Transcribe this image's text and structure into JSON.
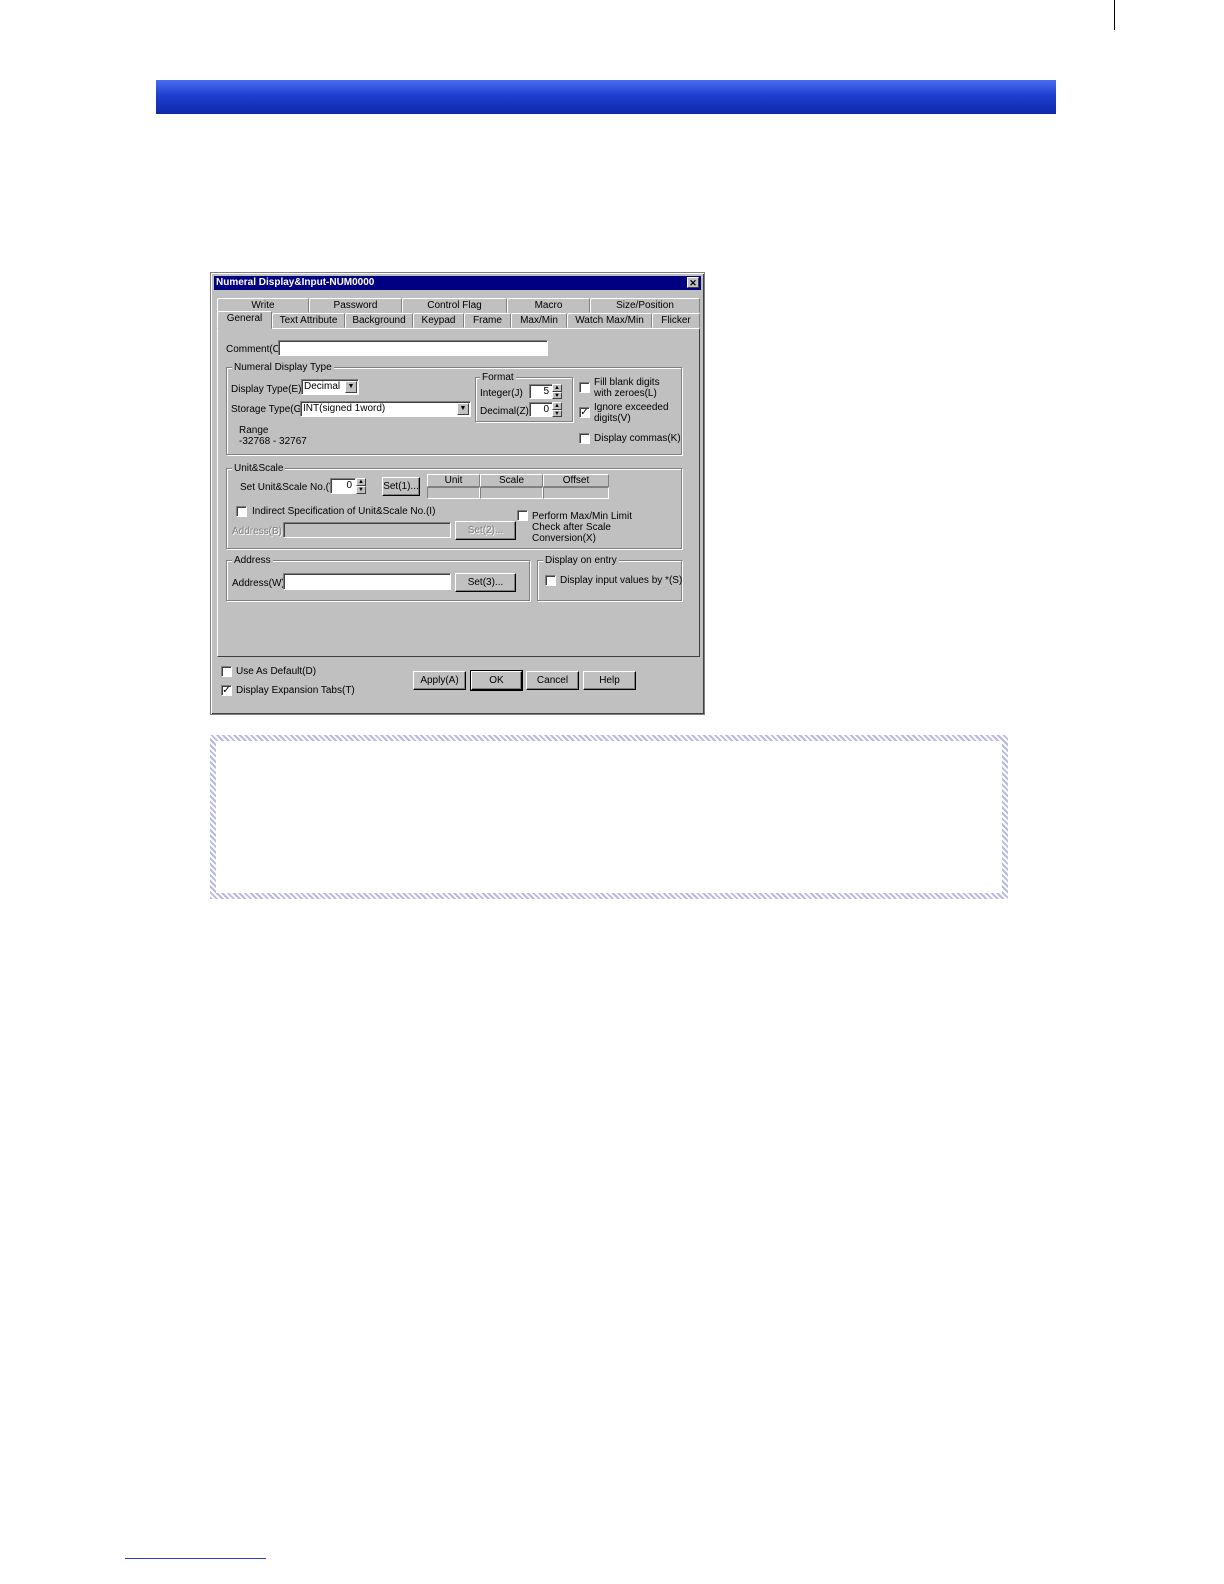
{
  "dialog": {
    "title": "Numeral Display&Input-NUM0000",
    "close_glyph": "✕",
    "tabs_row1": [
      "Write",
      "Password",
      "Control Flag",
      "Macro",
      "Size/Position"
    ],
    "tabs_row2": [
      "General",
      "Text Attribute",
      "Background",
      "Keypad",
      "Frame",
      "Max/Min",
      "Watch Max/Min",
      "Flicker"
    ],
    "active_tab": "General",
    "comment_label": "Comment(C)",
    "comment_value": "",
    "numeral_display_type": {
      "legend": "Numeral Display Type",
      "display_type_label": "Display Type(E)",
      "display_type_value": "Decimal",
      "storage_type_label": "Storage Type(G)",
      "storage_type_value": "INT(signed 1word)",
      "range_label": "Range",
      "range_value": "-32768 - 32767",
      "format_legend": "Format",
      "integer_label": "Integer(J)",
      "integer_value": "5",
      "decimal_label": "Decimal(Z)",
      "decimal_value": "0",
      "fill_blank_line1": "Fill blank digits",
      "fill_blank_line2": "with zeroes(L)",
      "fill_blank_checked": false,
      "ignore_exceeded_line1": "Ignore exceeded",
      "ignore_exceeded_line2": "digits(V)",
      "ignore_exceeded_checked": true,
      "display_commas_label": "Display commas(K)",
      "display_commas_checked": false
    },
    "unit_scale": {
      "legend": "Unit&Scale",
      "set_no_label": "Set Unit&Scale No.(Y)",
      "set_no_value": "0",
      "set_button": "Set(1)...",
      "col_unit": "Unit",
      "col_scale": "Scale",
      "col_offset": "Offset",
      "indirect_label": "Indirect Specification of Unit&Scale No.(I)",
      "indirect_checked": false,
      "address_label": "Address(B)",
      "address_value": "",
      "set2_button": "Set(2)...",
      "perform_line1": "Perform Max/Min Limit",
      "perform_line2": "Check after Scale",
      "perform_line3": "Conversion(X)",
      "perform_checked": false
    },
    "address": {
      "legend": "Address",
      "address_label": "Address(W)",
      "address_value": "",
      "set3_button": "Set(3)..."
    },
    "display_on_entry": {
      "legend": "Display on entry",
      "label": "Display input values by *(S)",
      "checked": false
    },
    "use_as_default_label": "Use As Default(D)",
    "use_as_default_checked": false,
    "display_expansion_label": "Display Expansion Tabs(T)",
    "display_expansion_checked": true,
    "apply_button": "Apply(A)",
    "ok_button": "OK",
    "cancel_button": "Cancel",
    "help_button": "Help",
    "check_glyph": "✓",
    "dropdown_glyph": "▼",
    "spin_up_glyph": "▲",
    "spin_down_glyph": "▼"
  },
  "colors": {
    "header_bar": "#1f3fcf",
    "titlebar": "#000080",
    "dialog_face": "#c0c0c0",
    "note_border": "#b9b9e6"
  }
}
